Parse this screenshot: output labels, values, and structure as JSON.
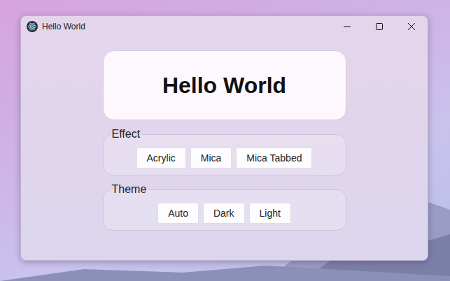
{
  "window": {
    "title": "Hello World"
  },
  "heading": "Hello World",
  "groups": [
    {
      "legend": "Effect",
      "buttons": [
        "Acrylic",
        "Mica",
        "Mica Tabbed"
      ]
    },
    {
      "legend": "Theme",
      "buttons": [
        "Auto",
        "Dark",
        "Light"
      ]
    }
  ]
}
